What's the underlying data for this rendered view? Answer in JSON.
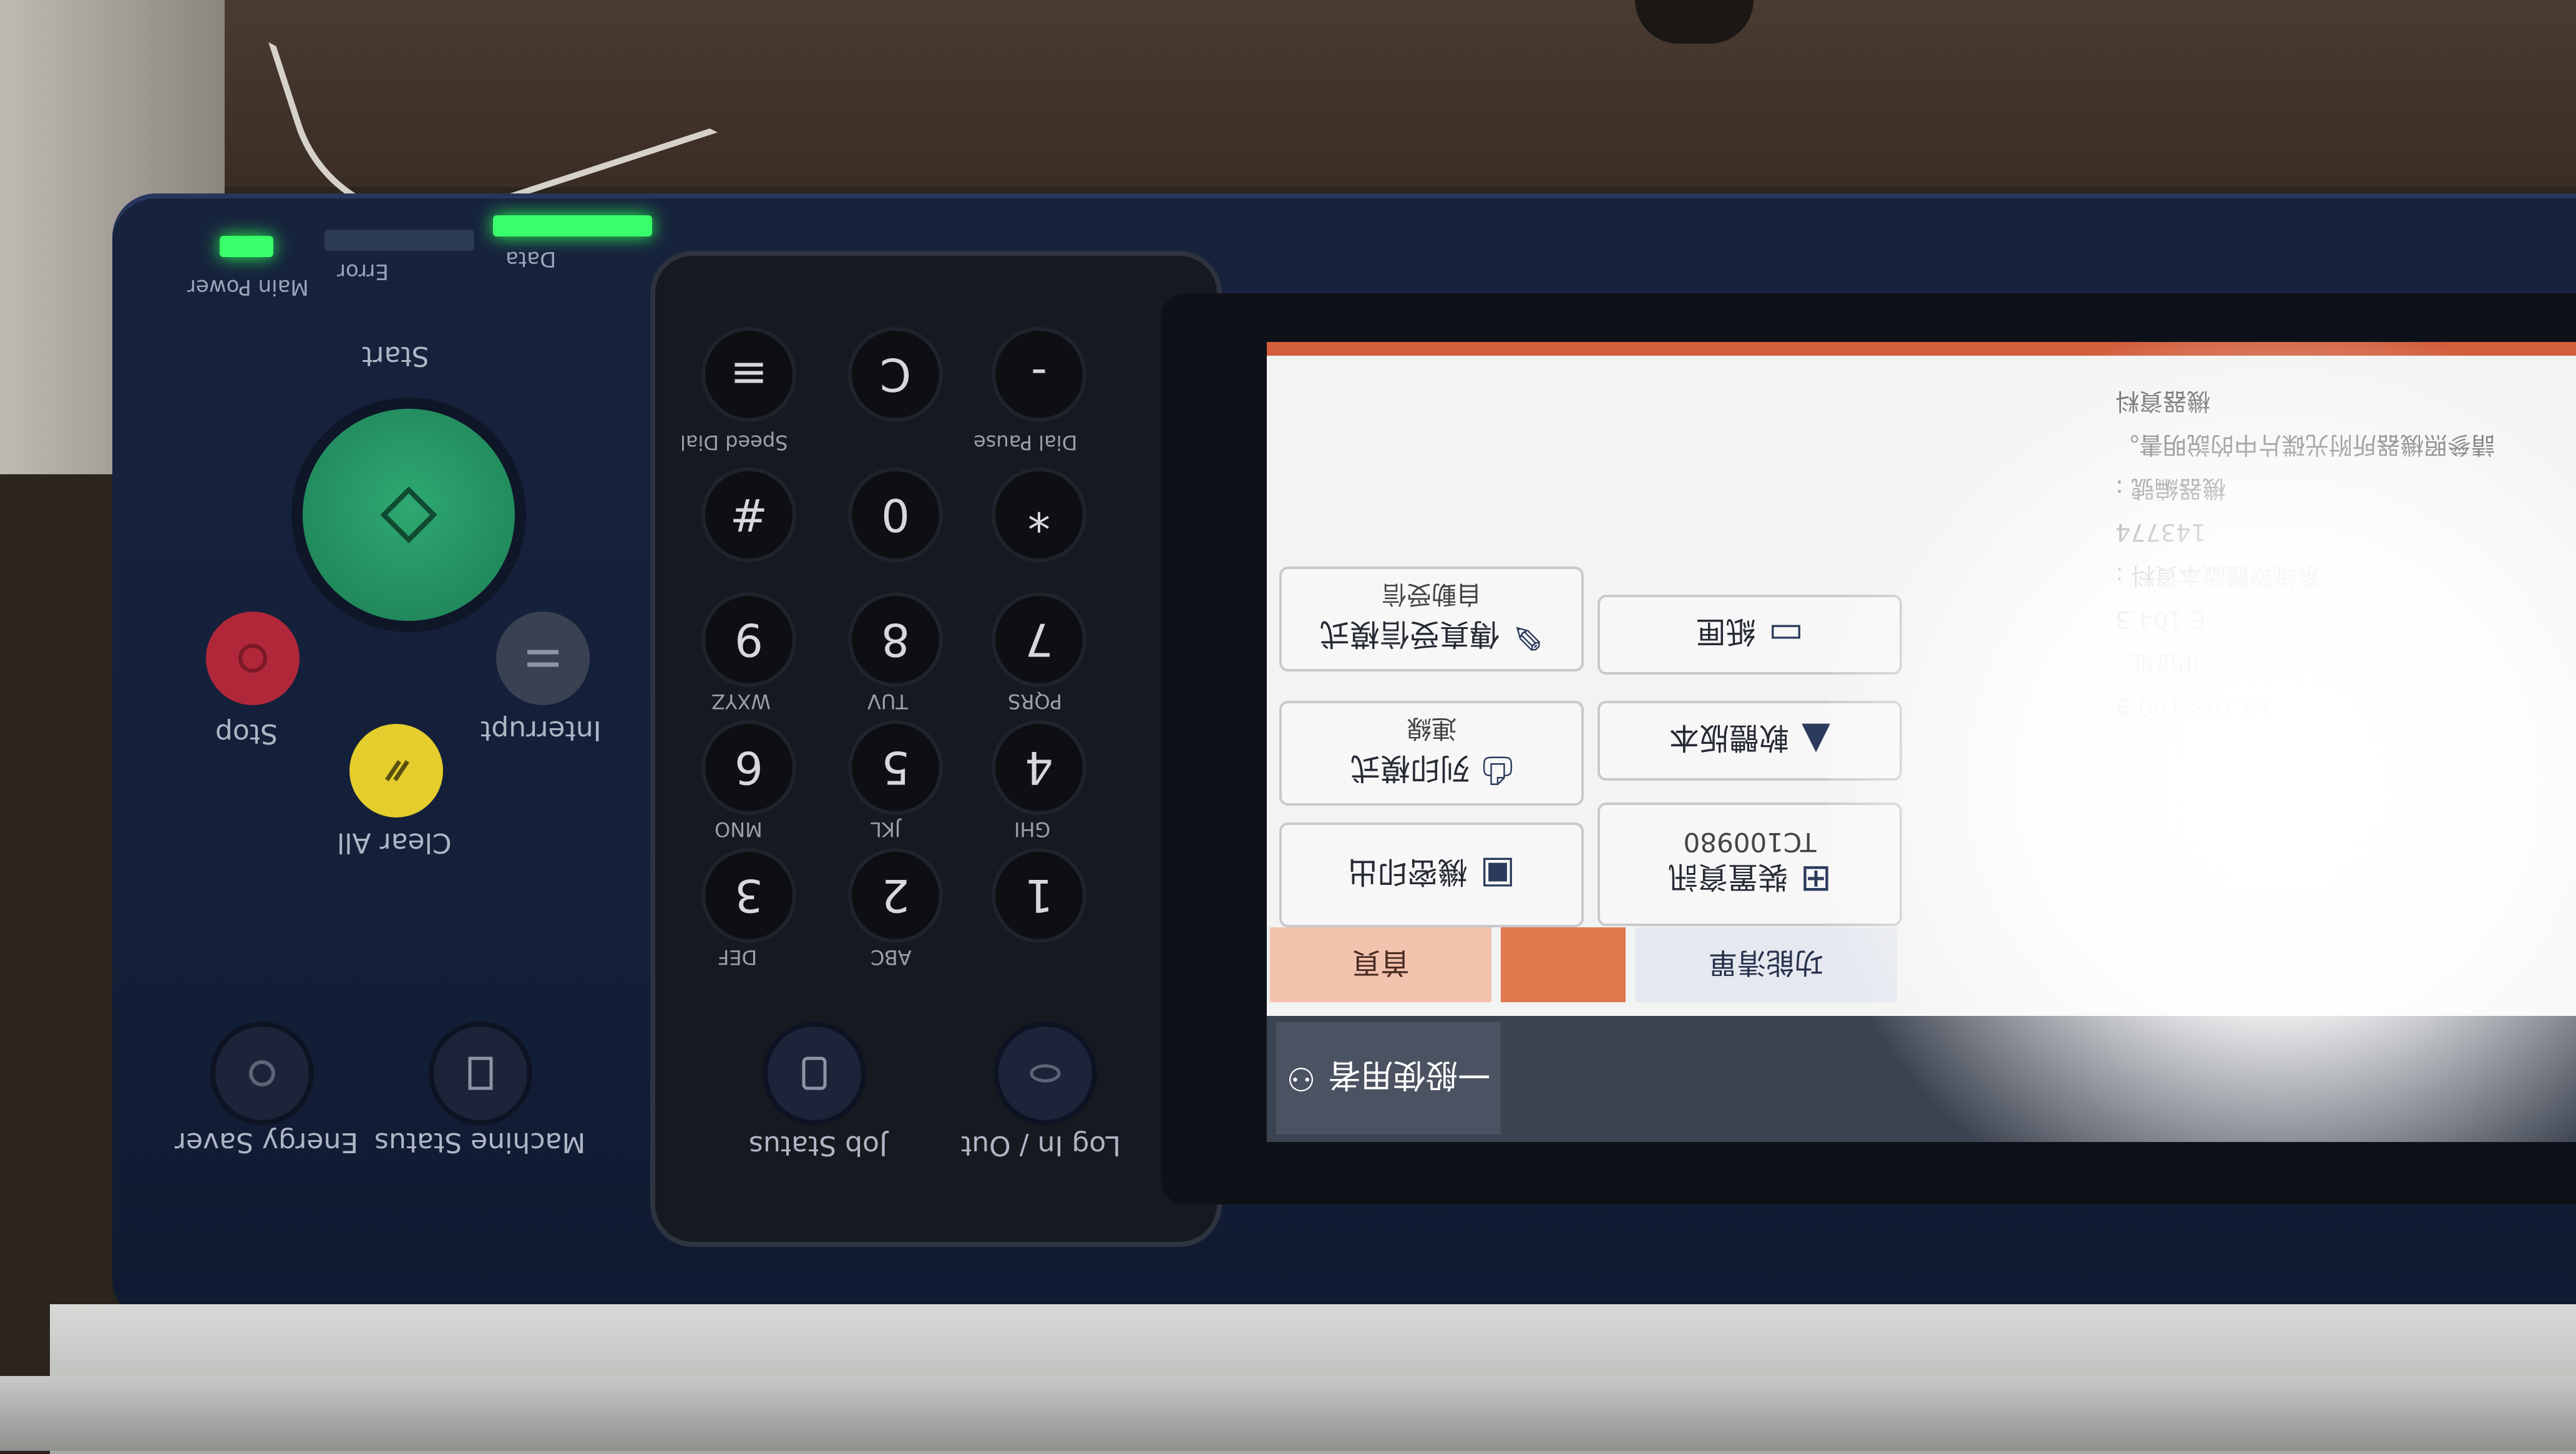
{
  "device": {
    "indicators": [
      {
        "label": "Main Power",
        "state": "on"
      },
      {
        "label": "Error",
        "state": "off"
      },
      {
        "label": "Data",
        "state": "on"
      }
    ],
    "control_buttons": {
      "start": "Start",
      "stop": "Stop",
      "clear_all": "Clear All",
      "interrupt": "Interrupt",
      "energy_saver": "Energy Saver",
      "machine_status": "Machine Status",
      "job_status": "Job Status",
      "log_in_out": "Log In / Out"
    },
    "keypad": {
      "row1": [
        {
          "key": "1",
          "sub": ""
        },
        {
          "key": "2",
          "sub": "ABC"
        },
        {
          "key": "3",
          "sub": "DEF"
        }
      ],
      "row2": [
        {
          "key": "4",
          "sub": "GHI"
        },
        {
          "key": "5",
          "sub": "JKL"
        },
        {
          "key": "6",
          "sub": "MNO"
        }
      ],
      "row3": [
        {
          "key": "7",
          "sub": "PQRS"
        },
        {
          "key": "8",
          "sub": "TUV"
        },
        {
          "key": "9",
          "sub": "WXYZ"
        }
      ],
      "row4": [
        {
          "key": "*",
          "sub": ""
        },
        {
          "key": "0",
          "sub": ""
        },
        {
          "key": "#",
          "sub": ""
        }
      ],
      "row5": [
        {
          "key": "-",
          "sub": "Dial Pause"
        },
        {
          "key": "C",
          "sub": ""
        },
        {
          "key": "",
          "sub": "Speed Dial"
        }
      ]
    }
  },
  "screen": {
    "user": "一般使用者",
    "tabs": {
      "home": "首頁",
      "function_list": "功能清單"
    },
    "tiles": {
      "secure_print": "機密印出",
      "print_mode": "列印模式",
      "print_mode_status": "連線",
      "fax_receive_mode": "傳真受信模式",
      "fax_receive_status": "自動受信",
      "device_info": "裝置資訊",
      "device_info_id": "TC100980",
      "software_version": "軟體版本",
      "paper": "紙匣"
    },
    "info_panel": {
      "ip_label": "IP位址 :",
      "ip_value": "10.193.160.9",
      "version_value": "E 104.3",
      "system_label": "系統軟體版本資料 :",
      "counter_value": "143774",
      "machine_label": "機器編號 :",
      "manual_note": "請參照機器所附光碟片中的說明書。",
      "machine_info_label": "機器資料"
    }
  }
}
